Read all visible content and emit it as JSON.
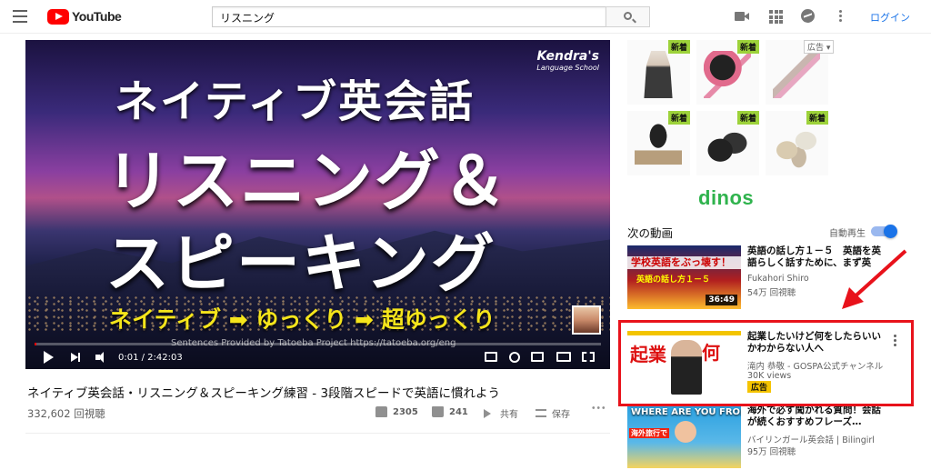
{
  "header": {
    "logo_text": "YouTube",
    "search_value": "リスニング",
    "login_label": "ログイン",
    "icons": [
      "hamburger-icon",
      "upload-video-icon",
      "apps-grid-icon",
      "messages-icon",
      "more-vert-icon"
    ]
  },
  "video": {
    "brand_line1": "Kendra's",
    "brand_line2": "Language School",
    "overlay_line1": "ネイティブ英会話",
    "overlay_line2": "リスニング＆",
    "overlay_line3": "スピーキング",
    "overlay_line4": "ネイティブ ➡ ゆっくり ➡ 超ゆっくり",
    "credit": "Sentences Provided by Tatoeba Project  https://tatoeba.org/eng",
    "time": "0:01 / 2:42:03",
    "progress_fraction": 0.001
  },
  "info": {
    "title": "ネイティブ英会話・リスニング＆スピーキング練習 - 3段階スピードで英語に慣れよう",
    "views": "332,602 回視聴",
    "likes": "2305",
    "dislikes": "241",
    "share_label": "共有",
    "save_label": "保存"
  },
  "ad": {
    "new_label": "新着",
    "ad_tag": "広告",
    "brand": "dinos"
  },
  "sidebar": {
    "up_next": "次の動画",
    "autoplay": "自動再生",
    "autoplay_on": true,
    "items": [
      {
        "title": "英語の話し方１－５　英語を英語らしく話すために、まず英",
        "channel": "Fukahori Shiro",
        "meta": "54万 回視聴",
        "duration": "36:49",
        "thumb_text": "学校英語をぶっ壊す！",
        "thumb_sub": "英語の話し方１－５"
      },
      {
        "title": "起業したいけど何をしたらいいかわからない人へ",
        "channel": "滝内 恭敬 - GOSPA公式チャンネル",
        "meta": "30K views",
        "badge": "広告",
        "thumb_text_1": "起業",
        "thumb_text_2": "何"
      },
      {
        "title": "海外で必ず聞かれる質問！会話が続くおすすめフレーズ…",
        "channel": "バイリンガール英会話 | Bilingirl",
        "meta": "95万 回視聴",
        "thumb_text": "WHERE ARE YOU FROM?",
        "thumb_tag": "海外旅行で"
      }
    ]
  }
}
